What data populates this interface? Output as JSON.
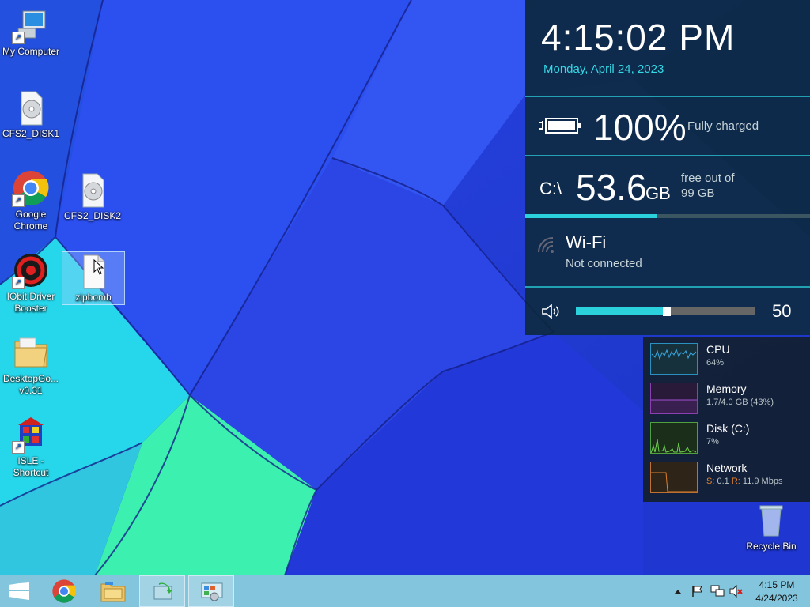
{
  "desktop": {
    "icons": [
      {
        "label": "My Computer"
      },
      {
        "label": "CFS2_DISK1"
      },
      {
        "label": "Google Chrome"
      },
      {
        "label": "CFS2_DISK2"
      },
      {
        "label": "IObit Driver Booster"
      },
      {
        "label": "zipbomb"
      },
      {
        "label": "DesktopGo... v0.31"
      },
      {
        "label": "ISLE - Shortcut"
      },
      {
        "label": "Recycle Bin"
      }
    ]
  },
  "panel": {
    "time": "4:15:02 PM",
    "date": "Monday, April 24, 2023",
    "battery": {
      "percent": "100%",
      "status": "Fully charged",
      "level": 1.0
    },
    "disk": {
      "letter": "C:\\",
      "value": "53.6",
      "unit": "GB",
      "free_line1": "free out of",
      "free_line2": "99 GB",
      "used_fraction": 0.46
    },
    "wifi": {
      "name": "Wi-Fi",
      "status": "Not connected"
    },
    "volume": {
      "value": "50",
      "level": 0.5
    }
  },
  "monitor": {
    "cpu": {
      "name": "CPU",
      "value": "64%"
    },
    "memory": {
      "name": "Memory",
      "value": "1.7/4.0 GB (43%)"
    },
    "disk": {
      "name": "Disk (C:)",
      "value": "7%"
    },
    "network": {
      "name": "Network",
      "s_label": "S:",
      "s_value": "0.1",
      "r_label": "R:",
      "r_value": "11.9 Mbps"
    }
  },
  "taskbar": {
    "time": "4:15 PM",
    "date": "4/24/2023"
  },
  "colors": {
    "accent": "#2bd2de",
    "panel_bg": "#0a2834",
    "taskbar": "#8cd0dc"
  }
}
